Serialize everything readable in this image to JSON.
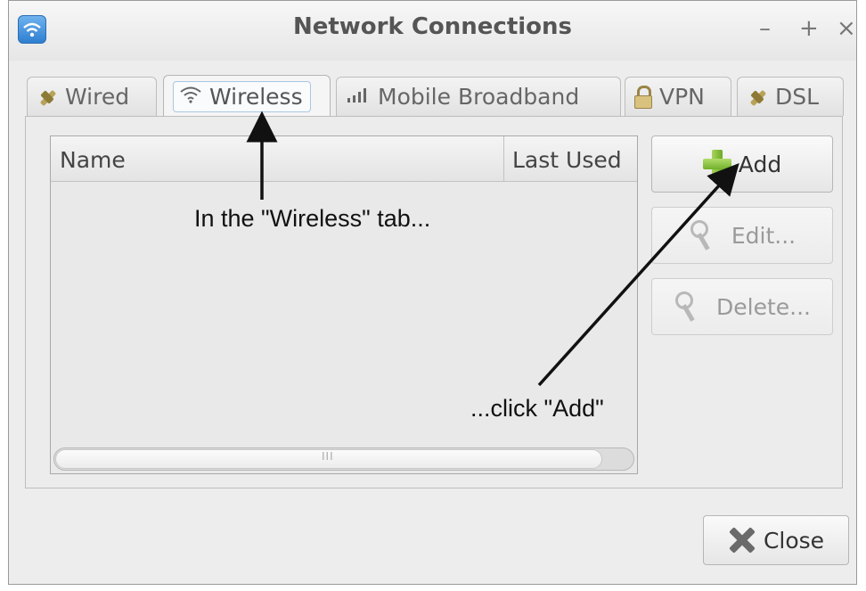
{
  "window": {
    "title": "Network Connections",
    "controls": {
      "minimize": "–",
      "maximize": "+",
      "close": "×"
    }
  },
  "tabs": [
    {
      "label": "Wired",
      "icon": "plug-icon",
      "selected": false
    },
    {
      "label": "Wireless",
      "icon": "wifi-icon",
      "selected": true
    },
    {
      "label": "Mobile Broadband",
      "icon": "signal-icon",
      "selected": false
    },
    {
      "label": "VPN",
      "icon": "lock-icon",
      "selected": false
    },
    {
      "label": "DSL",
      "icon": "plug-icon",
      "selected": false
    }
  ],
  "list": {
    "columns": [
      "Name",
      "Last Used"
    ],
    "rows": [],
    "scrollbar_grip": "III"
  },
  "buttons": {
    "add": "Add",
    "edit": "Edit...",
    "delete": "Delete...",
    "close": "Close"
  },
  "annotations": {
    "tab_hint": "In the \"Wireless\" tab...",
    "add_hint": "...click \"Add\""
  }
}
